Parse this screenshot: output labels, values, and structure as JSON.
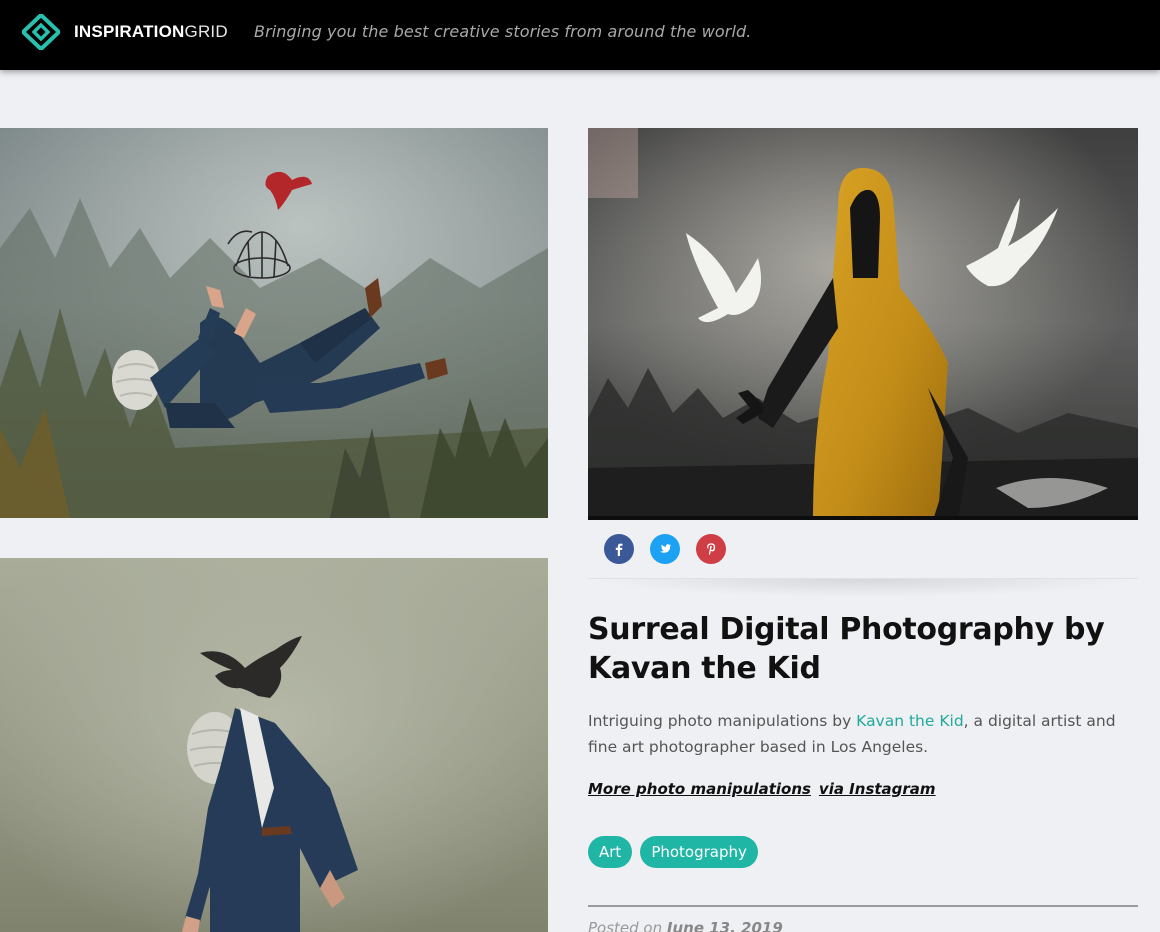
{
  "header": {
    "brand_bold": "INSPIRATION",
    "brand_light": "GRID",
    "tagline": "Bringing you the best creative stories from around the world."
  },
  "colors": {
    "accent": "#20b6a6",
    "link": "#20a99c",
    "header_bg": "#000000",
    "page_bg": "#eff0f4"
  },
  "social": [
    {
      "name": "facebook",
      "icon": "facebook-icon",
      "color": "#3b5998"
    },
    {
      "name": "twitter",
      "icon": "twitter-icon",
      "color": "#1da1f2"
    },
    {
      "name": "pinterest",
      "icon": "pinterest-icon",
      "color": "#cb2027"
    }
  ],
  "article": {
    "title": "Surreal Digital Photography by Kavan the Kid",
    "desc_before": "Intriguing photo manipulations by ",
    "desc_link": "Kavan the Kid",
    "desc_after": ", a digital artist and fine art photographer based in Los Angeles.",
    "more_label": "More photo manipulations",
    "via_label": "via Instagram",
    "tags": [
      "Art",
      "Photography"
    ],
    "posted_prefix": "Posted on",
    "posted_date": "June 13, 2019"
  }
}
